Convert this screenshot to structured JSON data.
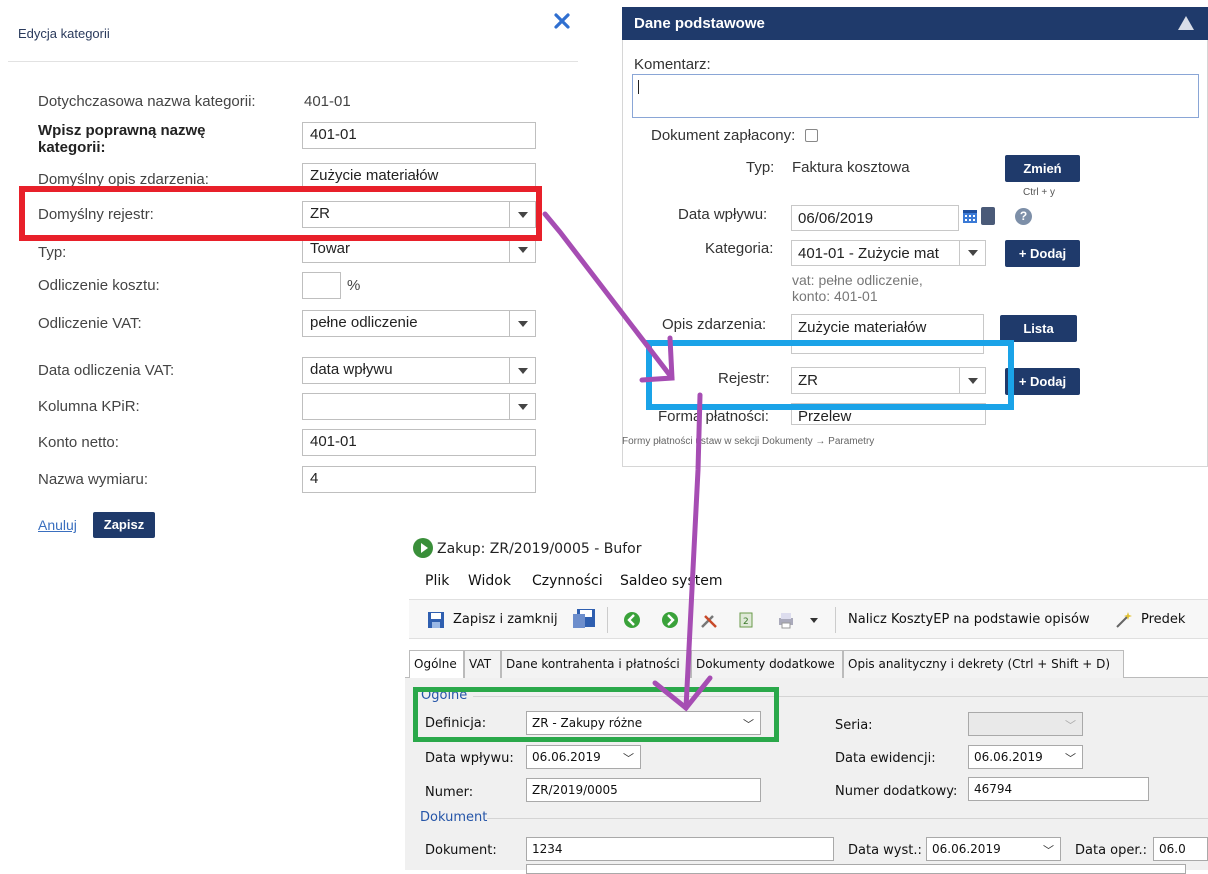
{
  "dialog": {
    "title": "Edycja kategorii",
    "close_icon": "close-icon",
    "fields": {
      "prev_name_label": "Dotychczasowa nazwa kategorii:",
      "prev_name_value": "401-01",
      "new_name_label": "Wpisz poprawną nazwę kategorii:",
      "new_name_value": "401-01",
      "default_desc_label": "Domyślny opis zdarzenia:",
      "default_desc_value": "Zużycie materiałów",
      "default_register_label": "Domyślny rejestr:",
      "default_register_value": "ZR",
      "type_label": "Typ:",
      "type_value": "Towar",
      "cost_deduction_label": "Odliczenie kosztu:",
      "cost_deduction_value": "",
      "cost_deduction_unit": "%",
      "vat_deduction_label": "Odliczenie VAT:",
      "vat_deduction_value": "pełne odliczenie",
      "vat_date_label": "Data odliczenia VAT:",
      "vat_date_value": "data wpływu",
      "kpir_label": "Kolumna KPiR:",
      "kpir_value": "",
      "net_account_label": "Konto netto:",
      "net_account_value": "401-01",
      "dimension_label": "Nazwa wymiaru:",
      "dimension_value": "4"
    },
    "cancel_label": "Anuluj",
    "save_label": "Zapisz"
  },
  "right_panel": {
    "title": "Dane podstawowe",
    "comment_label": "Komentarz:",
    "comment_value": "",
    "paid_label": "Dokument zapłacony:",
    "type_label": "Typ:",
    "type_value": "Faktura kosztowa",
    "change_label": "Zmień",
    "change_shortcut": "Ctrl + y",
    "receipt_date_label": "Data wpływu:",
    "receipt_date_value": "06/06/2019",
    "category_label": "Kategoria:",
    "category_value": "401-01 - Zużycie mat",
    "add_label": "+ Dodaj",
    "category_info_1": "vat: pełne odliczenie,",
    "category_info_2": "konto: 401-01",
    "event_desc_label": "Opis zdarzenia:",
    "event_desc_value": "Zużycie materiałów",
    "list_label": "Lista",
    "register_label": "Rejestr:",
    "register_value": "ZR",
    "add_register_label": "+ Dodaj",
    "payment_label": "Forma płatności:",
    "payment_value": "Przelew",
    "payment_hint": "Formy płatności ustaw w sekcji Dokumenty → Parametry"
  },
  "erp_window": {
    "title": "Zakup: ZR/2019/0005 - Bufor",
    "menu": [
      "Plik",
      "Widok",
      "Czynności",
      "Saldeo system"
    ],
    "toolbar": {
      "save_close": "Zapisz i zamknij",
      "calc_costs": "Nalicz KosztyEP na podstawie opisów",
      "predef": "Predek"
    },
    "tabs": [
      "Ogólne",
      "VAT",
      "Dane kontrahenta i płatności",
      "Dokumenty dodatkowe",
      "Opis analityczny i dekrety (Ctrl + Shift + D)"
    ],
    "group_general": "Ogólne",
    "definition_label": "Definicja:",
    "definition_value": "ZR - Zakupy różne",
    "receipt_date_label": "Data wpływu:",
    "receipt_date_value": "06.06.2019",
    "number_label": "Numer:",
    "number_value": "ZR/2019/0005",
    "series_label": "Seria:",
    "series_value": "",
    "record_date_label": "Data ewidencji:",
    "record_date_value": "06.06.2019",
    "extra_number_label": "Numer dodatkowy:",
    "extra_number_value": "46794",
    "group_document": "Dokument",
    "document_label": "Dokument:",
    "document_value": "1234",
    "issue_date_label": "Data wyst.:",
    "issue_date_value": "06.06.2019",
    "oper_date_label": "Data oper.:",
    "oper_date_value": "06.0"
  },
  "annotations": {
    "red": "#e8202a",
    "blue": "#1aa3e8",
    "green": "#2aa84a",
    "arrow": "#a64db3"
  }
}
